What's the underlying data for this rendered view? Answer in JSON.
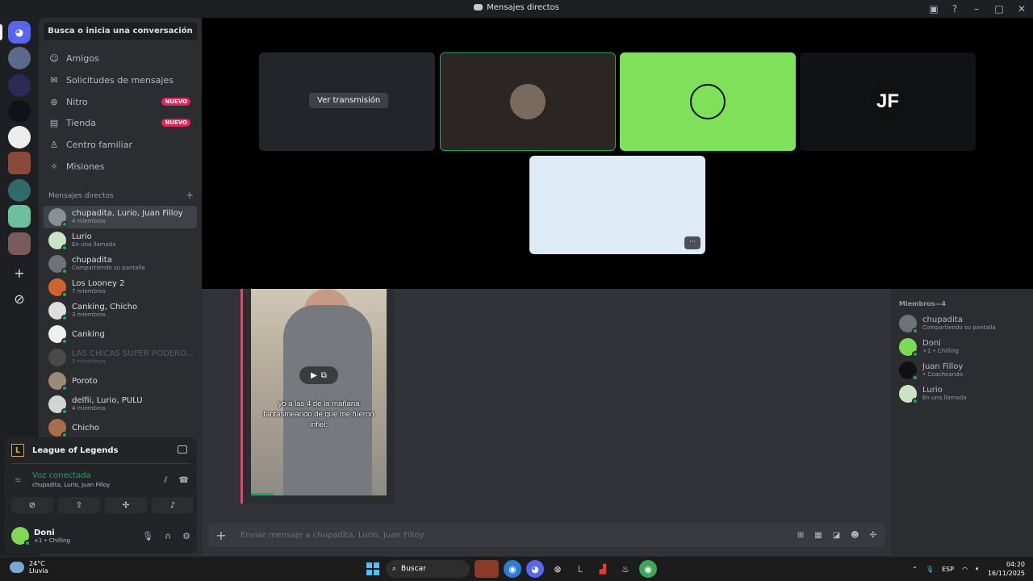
{
  "window": {
    "title": "Mensajes directos"
  },
  "sidebar": {
    "search_label": "Busca o inicia una conversación",
    "nav": [
      {
        "label": "Amigos",
        "badge": ""
      },
      {
        "label": "Solicitudes de mensajes",
        "badge": ""
      },
      {
        "label": "Nitro",
        "badge": "NUEVO"
      },
      {
        "label": "Tienda",
        "badge": "NUEVO"
      },
      {
        "label": "Centro familiar",
        "badge": ""
      },
      {
        "label": "Misiones",
        "badge": ""
      }
    ],
    "dm_header": "Mensajes directos",
    "dms": [
      {
        "name": "chupadita, Lurio, Juan Filloy",
        "sub": "4 miembros",
        "color": "#8a8f93",
        "active": true
      },
      {
        "name": "Lurio",
        "sub": "En una llamada",
        "color": "#c9e3c4"
      },
      {
        "name": "chupadita",
        "sub": "Compartiendo su pantalla",
        "color": "#6f7377"
      },
      {
        "name": "Los Looney 2",
        "sub": "7 miembros",
        "color": "#d0632d"
      },
      {
        "name": "Canking, Chicho",
        "sub": "3 miembros",
        "color": "#dedede"
      },
      {
        "name": "Canking",
        "sub": "",
        "color": "#f0f0f0"
      },
      {
        "name": "LAS CHICAS SUPER PODERO...",
        "sub": "5 miembros",
        "color": "#4a4a4a",
        "dim": true
      },
      {
        "name": "Poroto",
        "sub": "",
        "color": "#9a8a7a"
      },
      {
        "name": "delfii, Lurio, PULU",
        "sub": "4 miembros",
        "color": "#d4d4d4"
      },
      {
        "name": "Chicho",
        "sub": "",
        "color": "#a86e4a"
      }
    ]
  },
  "panel": {
    "game": "League of Legends",
    "voice_status": "Voz conectada",
    "voice_channel": "chupadita, Lurio, Juan Filloy",
    "user_name": "Doni",
    "user_status": "+1 • Chilling"
  },
  "call": {
    "stream_button": "Ver transmisión",
    "tile4_initials": "JF",
    "more": "···"
  },
  "chat": {
    "video_caption": "yo a las 4 de la mañana fantasmeando de que me fueron infiel:",
    "placeholder": "Enviar mensaje a chupadita, Lurio, Juan Filloy"
  },
  "members": {
    "header": "Miembros—4",
    "list": [
      {
        "name": "chupadita",
        "status": "Compartiendo su pantalla",
        "color": "#6f7377"
      },
      {
        "name": "Doni",
        "status": "+1 • Chilling",
        "color": "#7ed957"
      },
      {
        "name": "Juan Filloy",
        "status": "• Coacheando",
        "color": "#111111"
      },
      {
        "name": "Lurio",
        "status": "En una llamada",
        "color": "#c9e3c4"
      }
    ]
  },
  "taskbar": {
    "temp": "24°C",
    "weather": "Lluvia",
    "search": "Buscar",
    "lang": "ESP",
    "time": "04:20",
    "date": "16/11/2025"
  },
  "colors": {
    "accent": "#5865f2",
    "online": "#23a55a",
    "new_badge": "#e3245a",
    "mention_bar": "#f23f6b"
  }
}
